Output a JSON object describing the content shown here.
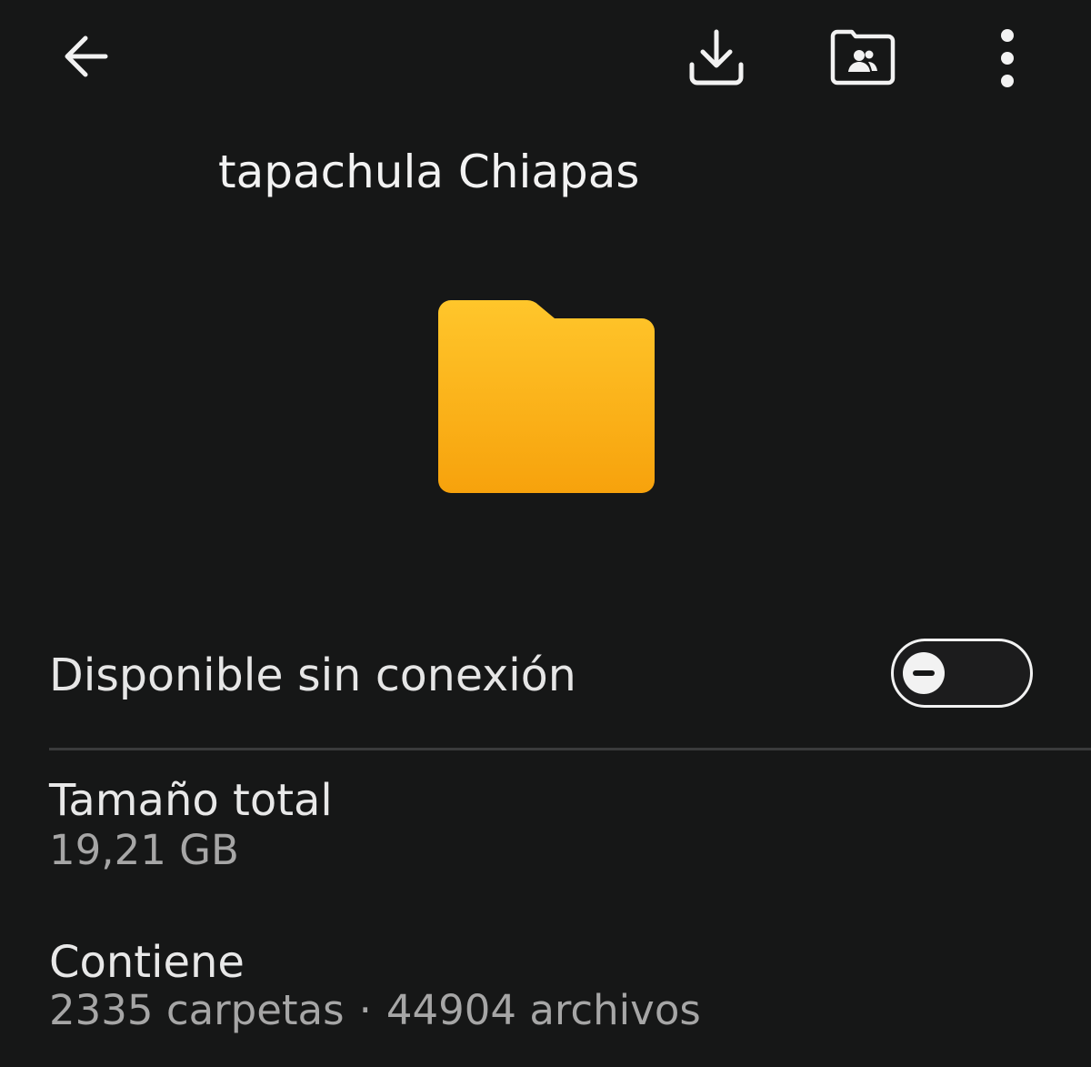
{
  "toolbar": {
    "back_icon": "arrow-left-icon",
    "download_icon": "download-icon",
    "shared_folder_icon": "folder-shared-icon",
    "more_icon": "more-vertical-icon"
  },
  "folder": {
    "name": "tapachula Chiapas",
    "icon": "folder-icon",
    "color_top": "#FFC62B",
    "color_bottom": "#F7A20C"
  },
  "offline": {
    "label": "Disponible sin conexión",
    "enabled": false
  },
  "details": {
    "size_label": "Tamaño total",
    "size_value": "19,21 GB",
    "contains_label": "Contiene",
    "folders": "2335 carpetas",
    "separator": "·",
    "files": "44904 archivos"
  }
}
